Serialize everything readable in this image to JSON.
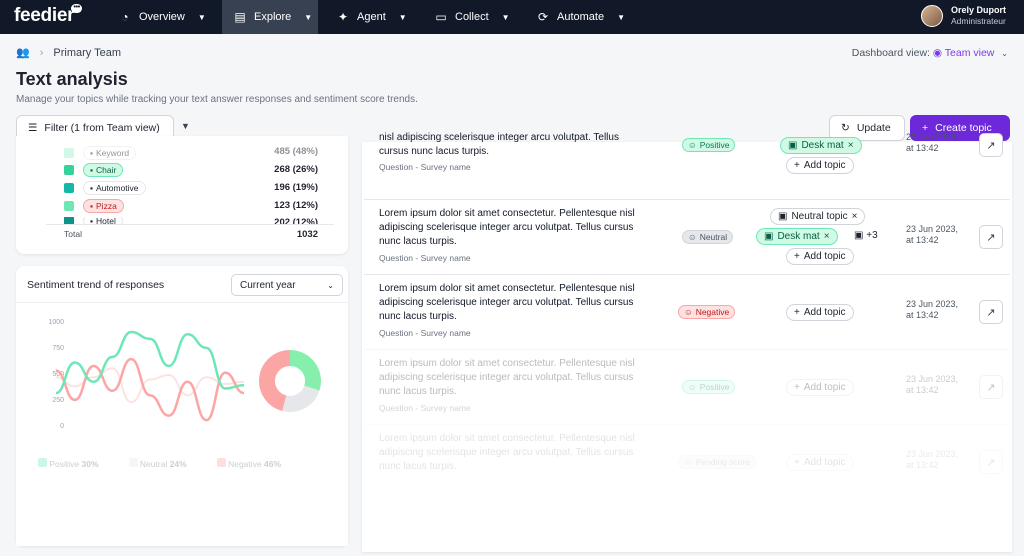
{
  "brand": {
    "logo": "feedier",
    "accent": "#6d28d9",
    "nav_bg": "#111827"
  },
  "nav": {
    "items": [
      {
        "label": "Overview",
        "icon": "gauge-icon"
      },
      {
        "label": "Explore",
        "icon": "document-icon"
      },
      {
        "label": "Agent",
        "icon": "sparkle-icon"
      },
      {
        "label": "Collect",
        "icon": "chat-icon"
      },
      {
        "label": "Automate",
        "icon": "automation-icon"
      }
    ]
  },
  "user": {
    "name": "Orely Duport",
    "role": "Administrateur"
  },
  "breadcrumb": {
    "team": "Primary Team"
  },
  "dashboard_view": {
    "label": "Dashboard view:",
    "value": "Team view"
  },
  "page": {
    "title": "Text analysis",
    "subtitle": "Manage your topics while tracking your text answer responses and sentiment score trends."
  },
  "toolbar": {
    "filter": "Filter (1 from Team view)",
    "update": "Update",
    "create": "Create topic"
  },
  "topics": {
    "rows": [
      {
        "name": "Keyword",
        "value": "485 (48%)",
        "color": "#a7f3d0"
      },
      {
        "name": "Chair",
        "value": "268 (26%)",
        "color": "#34d399"
      },
      {
        "name": "Automotive",
        "value": "196 (19%)",
        "color": "#14b8a6"
      },
      {
        "name": "Pizza",
        "value": "123 (12%)",
        "color": "#6ee7b7"
      },
      {
        "name": "Hotel",
        "value": "202 (12%)",
        "color": "#0d9488"
      }
    ],
    "total_label": "Total",
    "total_value": "1032"
  },
  "trend": {
    "title": "Sentiment trend of responses",
    "period": "Current year",
    "y_ticks": [
      "1000",
      "750",
      "500",
      "250",
      "0"
    ],
    "legend": [
      {
        "name": "Positive",
        "pct": "30%",
        "color": "#6ee7b7"
      },
      {
        "name": "Neutral",
        "pct": "24%",
        "color": "#e5e7eb"
      },
      {
        "name": "Negative",
        "pct": "46%",
        "color": "#fca5a5"
      }
    ]
  },
  "chart_data": {
    "type": "line",
    "ylim": [
      0,
      1000
    ],
    "series": [
      {
        "name": "Positive",
        "values": [
          380,
          650,
          480,
          700,
          920,
          860,
          620,
          900,
          780,
          420,
          450
        ]
      },
      {
        "name": "Negative",
        "values": [
          580,
          320,
          620,
          400,
          680,
          360,
          180,
          480,
          140,
          560,
          380
        ]
      },
      {
        "name": "Neutral",
        "values": [
          520,
          440,
          520,
          600,
          300,
          500,
          540,
          360,
          520,
          460,
          480
        ]
      }
    ],
    "donut": [
      {
        "name": "Positive",
        "value": 30
      },
      {
        "name": "Neutral",
        "value": 24
      },
      {
        "name": "Negative",
        "value": 46
      }
    ]
  },
  "responses": [
    {
      "text": "nisl adipiscing scelerisque integer arcu volutpat. Tellus cursus nunc lacus turpis.",
      "meta": "Question - Survey name",
      "sentiment": "Positive",
      "topics": [
        "Desk mat"
      ],
      "add": "Add topic",
      "date": "23 Jun 2023,",
      "time": "at 13:42"
    },
    {
      "text": "Lorem ipsum dolor sit amet consectetur. Pellentesque nisl adipiscing scelerisque integer arcu volutpat. Tellus cursus nunc lacus turpis.",
      "meta": "Question - Survey name",
      "sentiment": "Neutral",
      "topics": [
        "Neutral topic",
        "Desk mat"
      ],
      "more": "+3",
      "add": "Add topic",
      "date": "23 Jun 2023,",
      "time": "at 13:42"
    },
    {
      "text": "Lorem ipsum dolor sit amet consectetur. Pellentesque nisl adipiscing scelerisque integer arcu volutpat. Tellus cursus nunc lacus turpis.",
      "meta": "Question - Survey name",
      "sentiment": "Negative",
      "add": "Add topic",
      "date": "23 Jun 2023,",
      "time": "at 13:42"
    },
    {
      "text": "Lorem ipsum dolor sit amet consectetur. Pellentesque nisl adipiscing scelerisque integer arcu volutpat. Tellus cursus nunc lacus turpis.",
      "meta": "Question - Survey name",
      "sentiment": "Positive",
      "add": "Add topic",
      "date": "23 Jun 2023,",
      "time": "at 13:42"
    },
    {
      "text": "Lorem ipsum dolor sit amet consectetur. Pellentesque nisl adipiscing scelerisque integer arcu volutpat. Tellus cursus nunc lacus turpis.",
      "sentiment": "Pending score",
      "add": "Add topic",
      "date": "23 Jun 2023,",
      "time": "at 13:42"
    }
  ]
}
